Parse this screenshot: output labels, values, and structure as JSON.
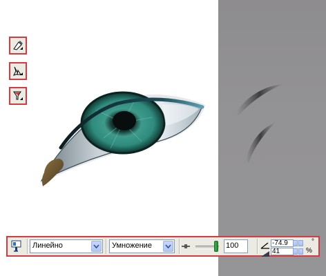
{
  "toolbox": {
    "tools": [
      {
        "icon": "eraser-pen-icon"
      },
      {
        "icon": "calligraphy-pen-icon"
      },
      {
        "icon": "smear-brush-icon"
      }
    ]
  },
  "canvas": {
    "background_left": "#ffffff",
    "background_right": "#939294"
  },
  "property_bar": {
    "tool_icon": "transparency-tool-icon",
    "transparency_type": "Линейно",
    "merge_mode": "Умножение",
    "opacity_icon": "opacity-slider-icon",
    "opacity_value": "100",
    "angle_icon": "angle-icon",
    "angle_value": "-74.9",
    "angle_unit": "°",
    "edge_icon": "edge-pad-icon",
    "edge_value": "41",
    "edge_unit": "%"
  },
  "colors": {
    "highlight_border": "#d8393f",
    "toolbar_bg": "#ecebe3",
    "iris": "#2e8b7d"
  }
}
